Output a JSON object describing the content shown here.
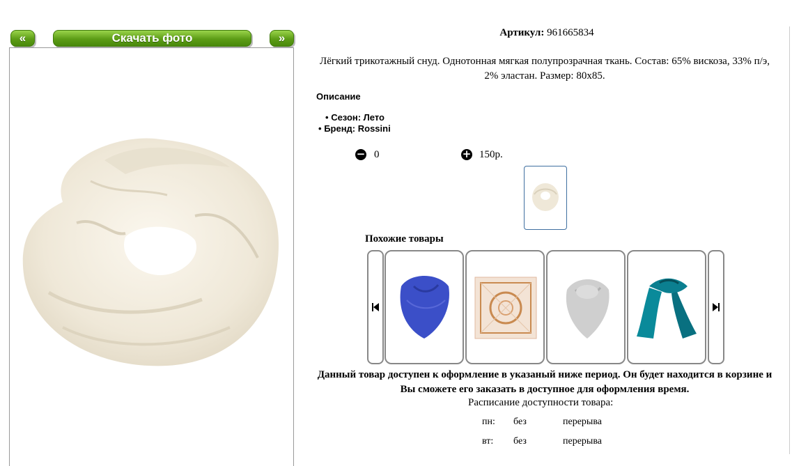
{
  "nav": {
    "prev_label": "«",
    "download_label": "Скачать фото",
    "next_label": "»"
  },
  "product": {
    "sku_label": "Артикул:",
    "sku_value": "961665834",
    "description_line1": "Лёгкий трикотажный снуд. Однотонная мягкая полупрозрачная ткань. Состав: 65% вискоза, 33% п/э,",
    "description_line2": "2% эластан. Размер: 80х85.",
    "section_title": "Описание",
    "season": "Сезон: Лето",
    "brand": "Бренд: Rossini",
    "quantity": "0",
    "price": "150р."
  },
  "similar": {
    "title": "Похожие товары",
    "items": [
      {
        "icon": "blue-scarf"
      },
      {
        "icon": "beige-pattern-square-scarf"
      },
      {
        "icon": "grey-scarf"
      },
      {
        "icon": "teal-scarf"
      }
    ]
  },
  "notice": {
    "line1": "Данный товар доступен к оформление в указаный ниже период. Он будет находится в корзине и",
    "line2": "Вы сможете его заказать в доступное для оформления время."
  },
  "schedule": {
    "title": "Расписание доступности товара:",
    "rows": [
      {
        "day": "пн:",
        "a": "без",
        "b": "перерыва"
      },
      {
        "day": "вт:",
        "a": "без",
        "b": "перерыва"
      }
    ]
  },
  "colors": {
    "button_green": "#5c9c16",
    "scarf_cream": "#f3ede0",
    "thumb_border": "#3f6fa0"
  }
}
